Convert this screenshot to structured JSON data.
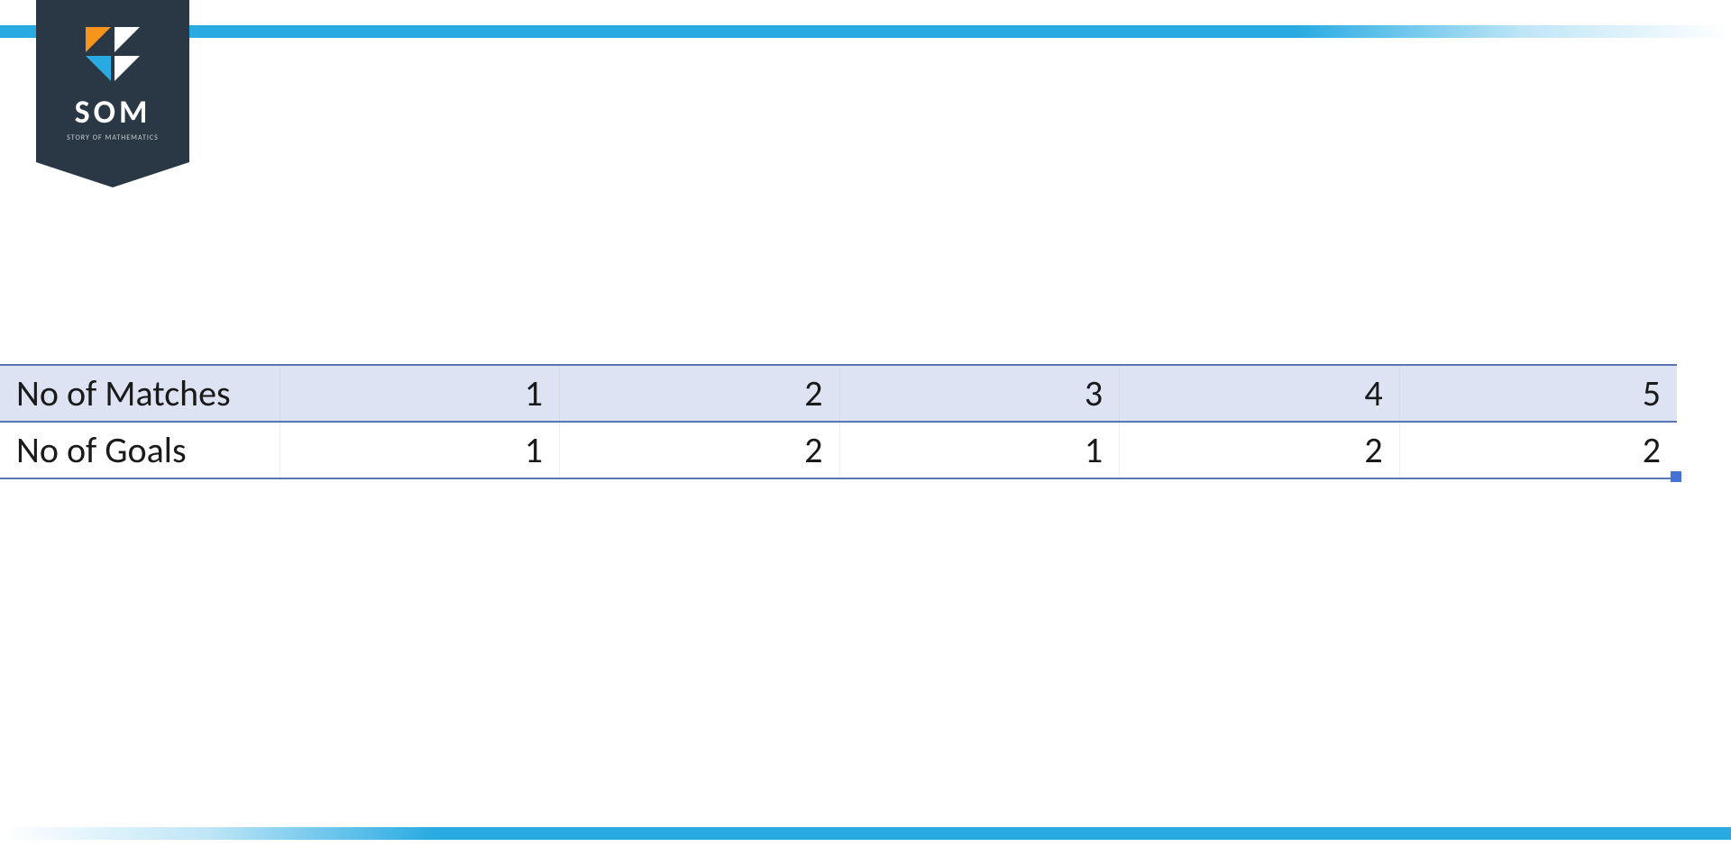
{
  "logo": {
    "title": "SOM",
    "subtitle": "STORY OF MATHEMATICS"
  },
  "chart_data": {
    "type": "table",
    "rows": [
      {
        "label": "No of Matches",
        "values": [
          1,
          2,
          3,
          4,
          5
        ]
      },
      {
        "label": "No of Goals",
        "values": [
          1,
          2,
          1,
          2,
          2
        ]
      }
    ]
  }
}
